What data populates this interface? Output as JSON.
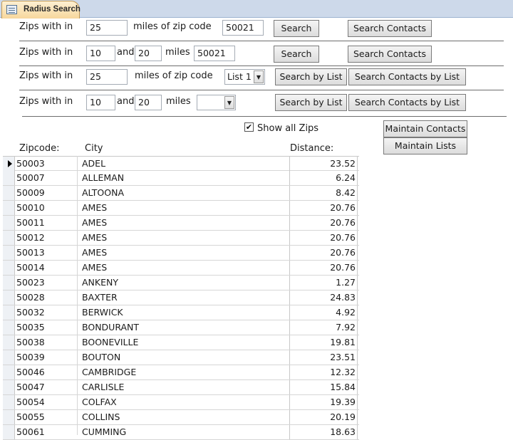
{
  "tab": {
    "label": "Radius Search",
    "icon": "form-icon"
  },
  "rows": [
    {
      "label_prefix": "Zips with in",
      "miles": "25",
      "label_mid": "miles of zip code",
      "zip": "50021",
      "search_label": "Search",
      "contacts_label": "Search Contacts"
    },
    {
      "label_prefix": "Zips with in",
      "from": "10",
      "and_label": "and",
      "to": "20",
      "miles_label": "miles",
      "zip": "50021",
      "search_label": "Search",
      "contacts_label": "Search Contacts"
    },
    {
      "label_prefix": "Zips with in",
      "miles": "25",
      "label_mid": "miles of zip code",
      "list": "List 1",
      "search_label": "Search by List",
      "contacts_label": "Search Contacts by List"
    },
    {
      "label_prefix": "Zips with in",
      "from": "10",
      "and_label": "and",
      "to": "20",
      "miles_label": "miles",
      "list": "",
      "search_label": "Search by List",
      "contacts_label": "Search Contacts by List"
    }
  ],
  "show_all": {
    "label": "Show all Zips",
    "checked": true
  },
  "buttons": {
    "maintain_contacts": "Maintain Contacts",
    "maintain_lists": "Maintain Lists"
  },
  "table": {
    "headers": {
      "zip": "Zipcode:",
      "city": "City",
      "distance": "Distance:"
    },
    "rows": [
      {
        "zip": "50003",
        "city": "ADEL",
        "distance": "23.52"
      },
      {
        "zip": "50007",
        "city": "ALLEMAN",
        "distance": "6.24"
      },
      {
        "zip": "50009",
        "city": "ALTOONA",
        "distance": "8.42"
      },
      {
        "zip": "50010",
        "city": "AMES",
        "distance": "20.76"
      },
      {
        "zip": "50011",
        "city": "AMES",
        "distance": "20.76"
      },
      {
        "zip": "50012",
        "city": "AMES",
        "distance": "20.76"
      },
      {
        "zip": "50013",
        "city": "AMES",
        "distance": "20.76"
      },
      {
        "zip": "50014",
        "city": "AMES",
        "distance": "20.76"
      },
      {
        "zip": "50023",
        "city": "ANKENY",
        "distance": "1.27"
      },
      {
        "zip": "50028",
        "city": "BAXTER",
        "distance": "24.83"
      },
      {
        "zip": "50032",
        "city": "BERWICK",
        "distance": "4.92"
      },
      {
        "zip": "50035",
        "city": "BONDURANT",
        "distance": "7.92"
      },
      {
        "zip": "50038",
        "city": "BOONEVILLE",
        "distance": "19.81"
      },
      {
        "zip": "50039",
        "city": "BOUTON",
        "distance": "23.51"
      },
      {
        "zip": "50046",
        "city": "CAMBRIDGE",
        "distance": "12.32"
      },
      {
        "zip": "50047",
        "city": "CARLISLE",
        "distance": "15.84"
      },
      {
        "zip": "50054",
        "city": "COLFAX",
        "distance": "19.39"
      },
      {
        "zip": "50055",
        "city": "COLLINS",
        "distance": "20.19"
      },
      {
        "zip": "50061",
        "city": "CUMMING",
        "distance": "18.63"
      }
    ]
  }
}
